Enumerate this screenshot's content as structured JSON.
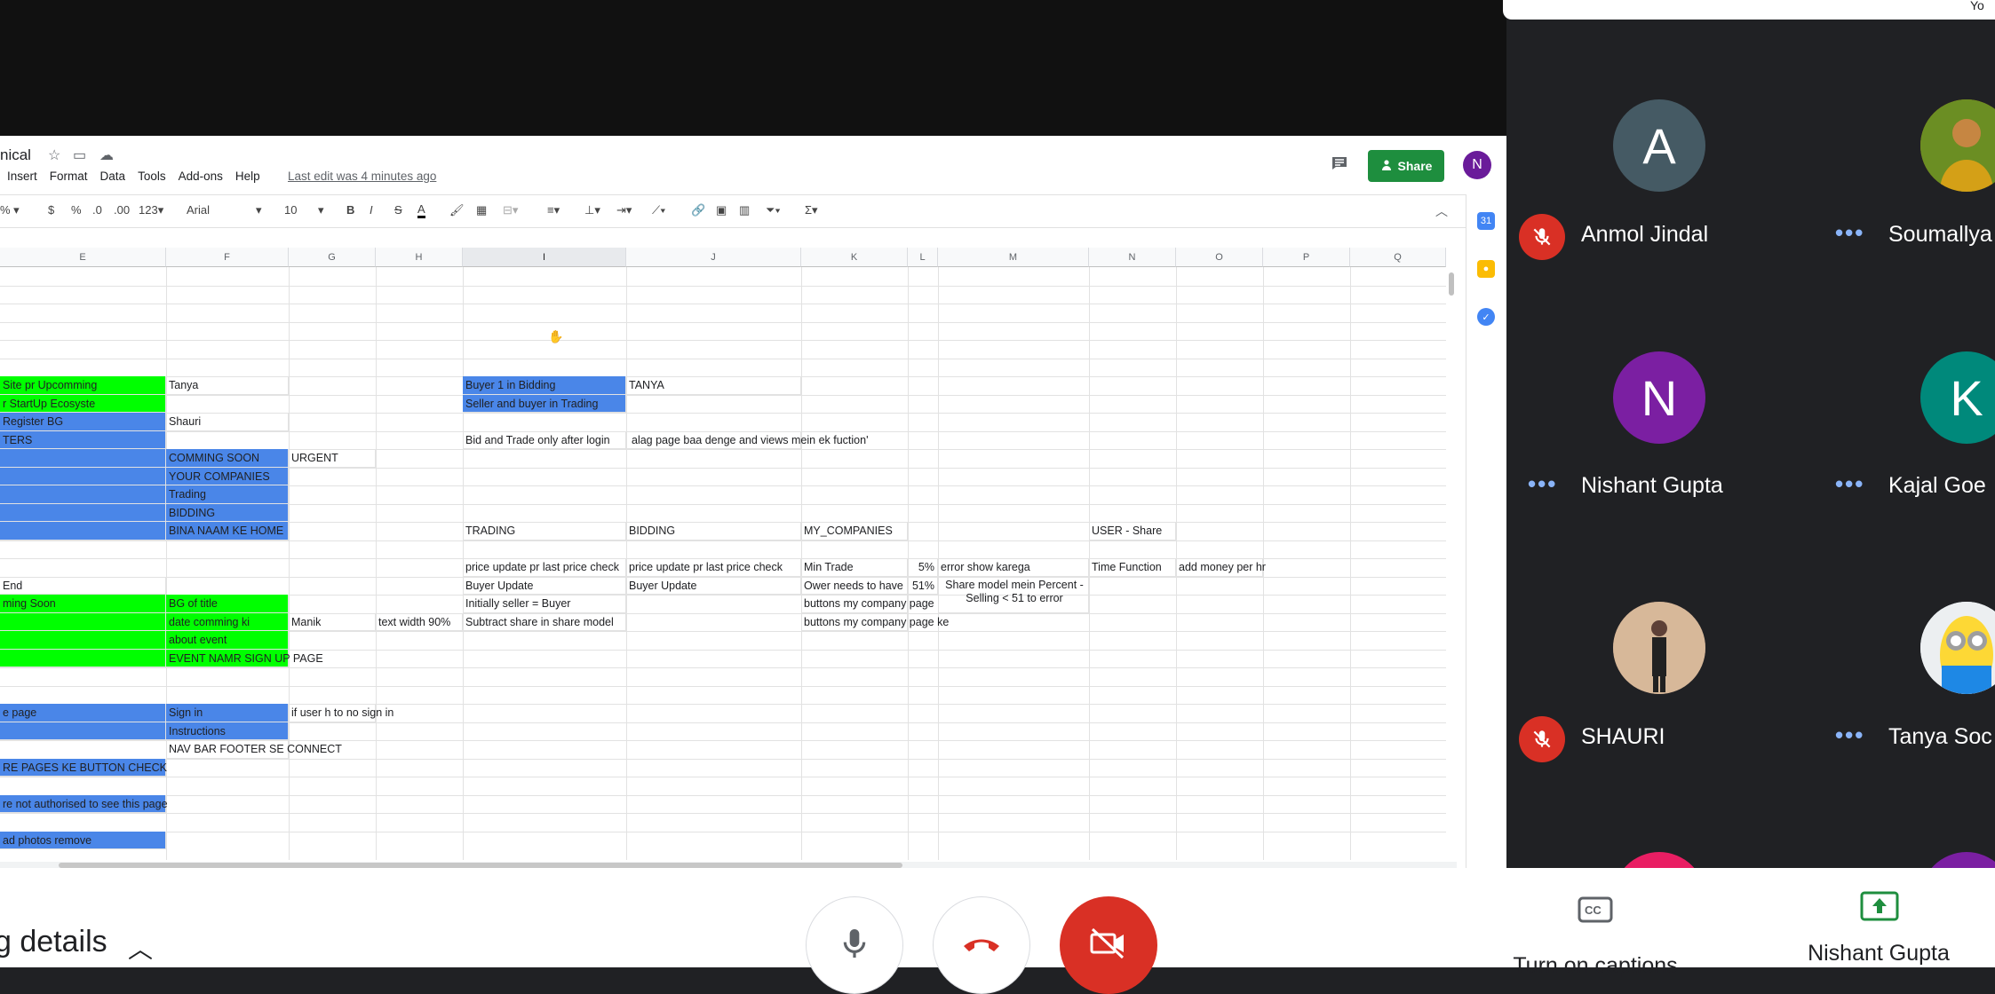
{
  "meeting": {
    "top_right_text": "Yo",
    "meeting_details_label": "g details",
    "captions_label": "Turn on captions",
    "presenter_name": "Nishant Gupta"
  },
  "sheet": {
    "title": "nical",
    "menu": [
      "Insert",
      "Format",
      "Data",
      "Tools",
      "Add-ons",
      "Help"
    ],
    "last_edit": "Last edit was 4 minutes ago",
    "share_label": "Share",
    "avatar_letter": "N",
    "toolbar": {
      "percent": "%",
      "currency": "$",
      "percent_fmt": "%",
      "dec_decrease": ".0",
      "dec_increase": ".00",
      "more_formats": "123",
      "font": "Arial",
      "font_size": "10",
      "bold": "B",
      "italic": "I",
      "strike": "S",
      "text_color": "A"
    },
    "columns": [
      "E",
      "F",
      "G",
      "H",
      "I",
      "J",
      "K",
      "L",
      "M",
      "N",
      "O",
      "P",
      "Q"
    ],
    "cells": {
      "e4": "Site pr Upcomming",
      "e5": "r StartUp Ecosyste",
      "e6": "Register BG",
      "e7": "TERS",
      "e13": "End",
      "e14": "ming Soon",
      "e20": "e page",
      "e24": "RE PAGES KE BUTTON CHECK",
      "e26": "re not authorised to see this page",
      "e28": "ad photos remove",
      "f4": "Tanya",
      "f6": "Shauri",
      "f8": "COMMING SOON",
      "f9": "YOUR COMPANIES",
      "f10": "Trading",
      "f11": "BIDDING",
      "f12": "BINA NAAM KE HOME",
      "f14": "BG of title",
      "f15": "date comming ki",
      "f16": "about event",
      "f17": "EVENT NAMR SIGN UP PAGE",
      "f20": "Sign in",
      "f21": "Instructions",
      "f22": "NAV BAR FOOTER SE CONNECT",
      "g8": "URGENT",
      "g15": "Manik",
      "g20": "if user h to no sign in",
      "h15": "text width 90%",
      "i4": "Buyer 1 in Bidding",
      "i5": "Seller and buyer in Trading",
      "i7": "Bid and Trade only after login",
      "i12": "TRADING",
      "i14": "price update pr last price check",
      "i15": "Buyer Update",
      "i16": "Initially seller = Buyer",
      "i17": "Subtract share in share model",
      "j4": "TANYA",
      "j7": "alag page baa denge and views mein ek fuction'",
      "j12": "BIDDING",
      "j14": "price update pr last price check",
      "j15": "Buyer Update",
      "k12": "MY_COMPANIES",
      "k14": "Min Trade",
      "k15": "Ower needs to have",
      "k16": "buttons my company page",
      "k17": "buttons my company page ke",
      "l14": "5%",
      "l15": "51%",
      "m14": "error show karega",
      "m15a": "Share model mein Percent -",
      "m15b": "Selling < 51 to error",
      "n12": "USER - Share",
      "n14": "Time Function",
      "o14": "add money per hr"
    }
  },
  "participants": [
    {
      "name": "Anmol Jindal",
      "letter": "A",
      "color": "#455a64",
      "muted": true
    },
    {
      "name": "Soumallya",
      "letter": "",
      "color": "#b8860b",
      "muted": false
    },
    {
      "name": "Nishant Gupta",
      "letter": "N",
      "color": "#7b1fa2",
      "muted": false
    },
    {
      "name": "Kajal Goe",
      "letter": "K",
      "color": "#00897b",
      "muted": false
    },
    {
      "name": "SHAURI",
      "letter": "",
      "color": "#8d6e63",
      "muted": true
    },
    {
      "name": "Tanya Soc",
      "letter": "",
      "color": "#fdd835",
      "muted": false
    }
  ]
}
